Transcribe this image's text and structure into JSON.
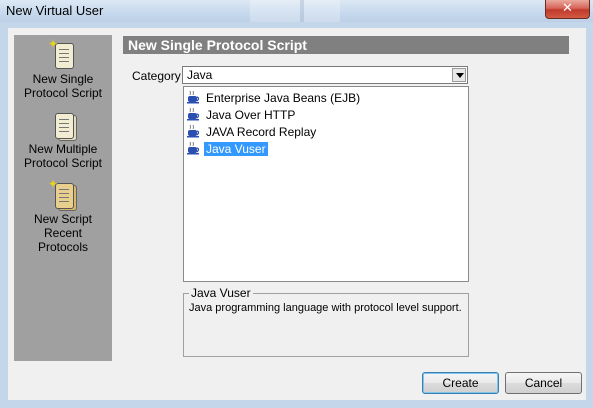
{
  "window": {
    "title": "New Virtual User",
    "close_glyph": "✕"
  },
  "sidebar": {
    "items": [
      {
        "label_line1": "New Single",
        "label_line2": "Protocol Script",
        "icon": "script-icon"
      },
      {
        "label_line1": "New Multiple",
        "label_line2": "Protocol Script",
        "icon": "multi-script-icon"
      },
      {
        "label_line1": "New Script",
        "label_line2": "Recent",
        "label_line3": "Protocols",
        "icon": "recent-script-icon"
      }
    ]
  },
  "main": {
    "header": "New Single Protocol Script",
    "category_label": "Category :",
    "category_value": "Java",
    "protocols": [
      {
        "label": "Enterprise Java Beans (EJB)",
        "selected": false
      },
      {
        "label": "Java Over HTTP",
        "selected": false
      },
      {
        "label": "JAVA Record Replay",
        "selected": false
      },
      {
        "label": "Java Vuser",
        "selected": true
      }
    ],
    "description": {
      "title": "Java Vuser",
      "text": "Java programming language with protocol level support."
    }
  },
  "buttons": {
    "create": "Create",
    "cancel": "Cancel"
  },
  "colors": {
    "selection": "#3399ff",
    "header_bg": "#808080",
    "sidebar_bg": "#a0a0a0"
  }
}
